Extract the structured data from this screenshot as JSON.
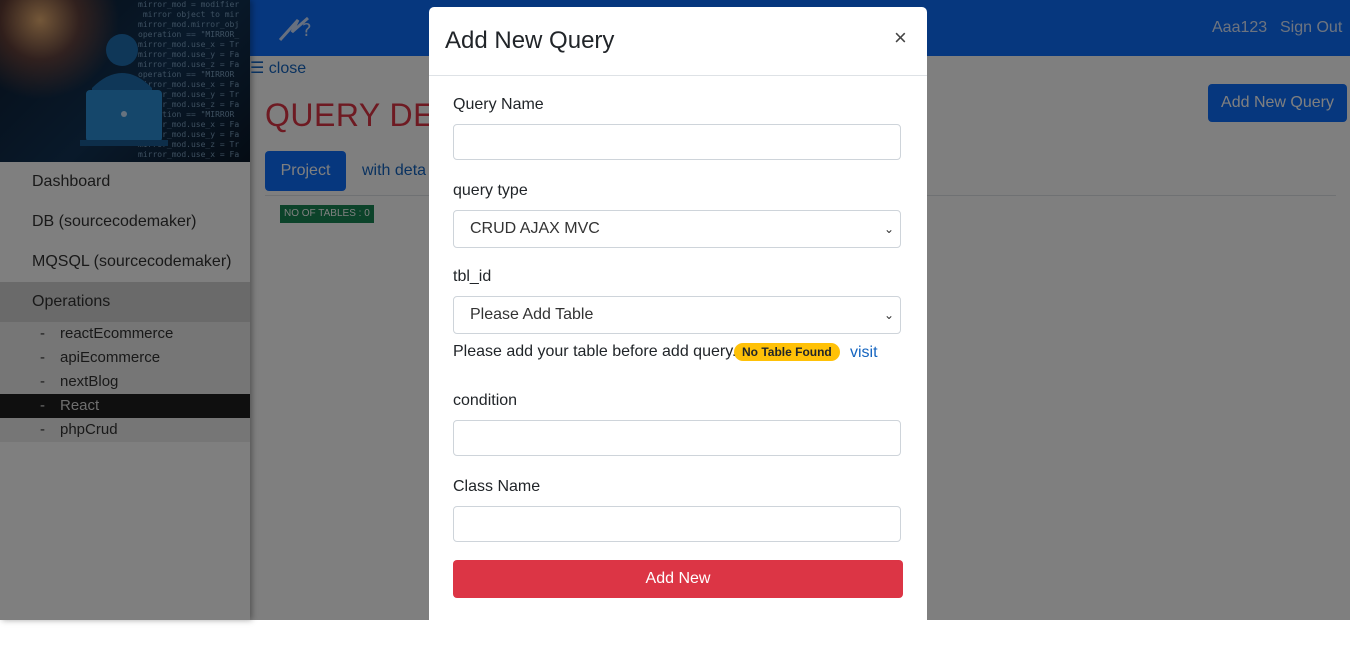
{
  "navbar": {
    "user_label": "Aaa123",
    "signout_label": "Sign Out"
  },
  "sidebar": {
    "items": [
      {
        "label": "Dashboard"
      },
      {
        "label": "DB (sourcecodemaker)"
      },
      {
        "label": "MQSQL (sourcecodemaker)"
      },
      {
        "label": "Operations"
      }
    ],
    "sub_items": [
      {
        "dash": "-",
        "label": "reactEcommerce"
      },
      {
        "dash": "-",
        "label": "apiEcommerce"
      },
      {
        "dash": "-",
        "label": "nextBlog"
      },
      {
        "dash": "-",
        "label": "React"
      },
      {
        "dash": "-",
        "label": "phpCrud"
      }
    ]
  },
  "main": {
    "close_label": "☰ close",
    "page_title": "QUERY DETA",
    "add_query_label": "Add New Query",
    "tabs": [
      {
        "label": "Project"
      },
      {
        "label": "with deta"
      }
    ],
    "tables_badge": "NO OF TABLES : 0"
  },
  "modal": {
    "title": "Add New Query",
    "close_symbol": "×",
    "query_name_label": "Query Name",
    "query_name_value": "",
    "query_type_label": "query type",
    "query_type_value": "CRUD AJAX MVC",
    "tbl_id_label": "tbl_id",
    "tbl_id_value": "Please Add Table",
    "hint_text": "Please add your table before add query.",
    "warn_badge": "No Table Found",
    "visit_label": "visit",
    "condition_label": "condition",
    "condition_value": "",
    "class_name_label": "Class Name",
    "class_name_value": "",
    "submit_label": "Add New"
  },
  "colors": {
    "primary": "#0d6efd",
    "danger": "#dc3545",
    "success": "#198754",
    "warning": "#ffc107"
  }
}
